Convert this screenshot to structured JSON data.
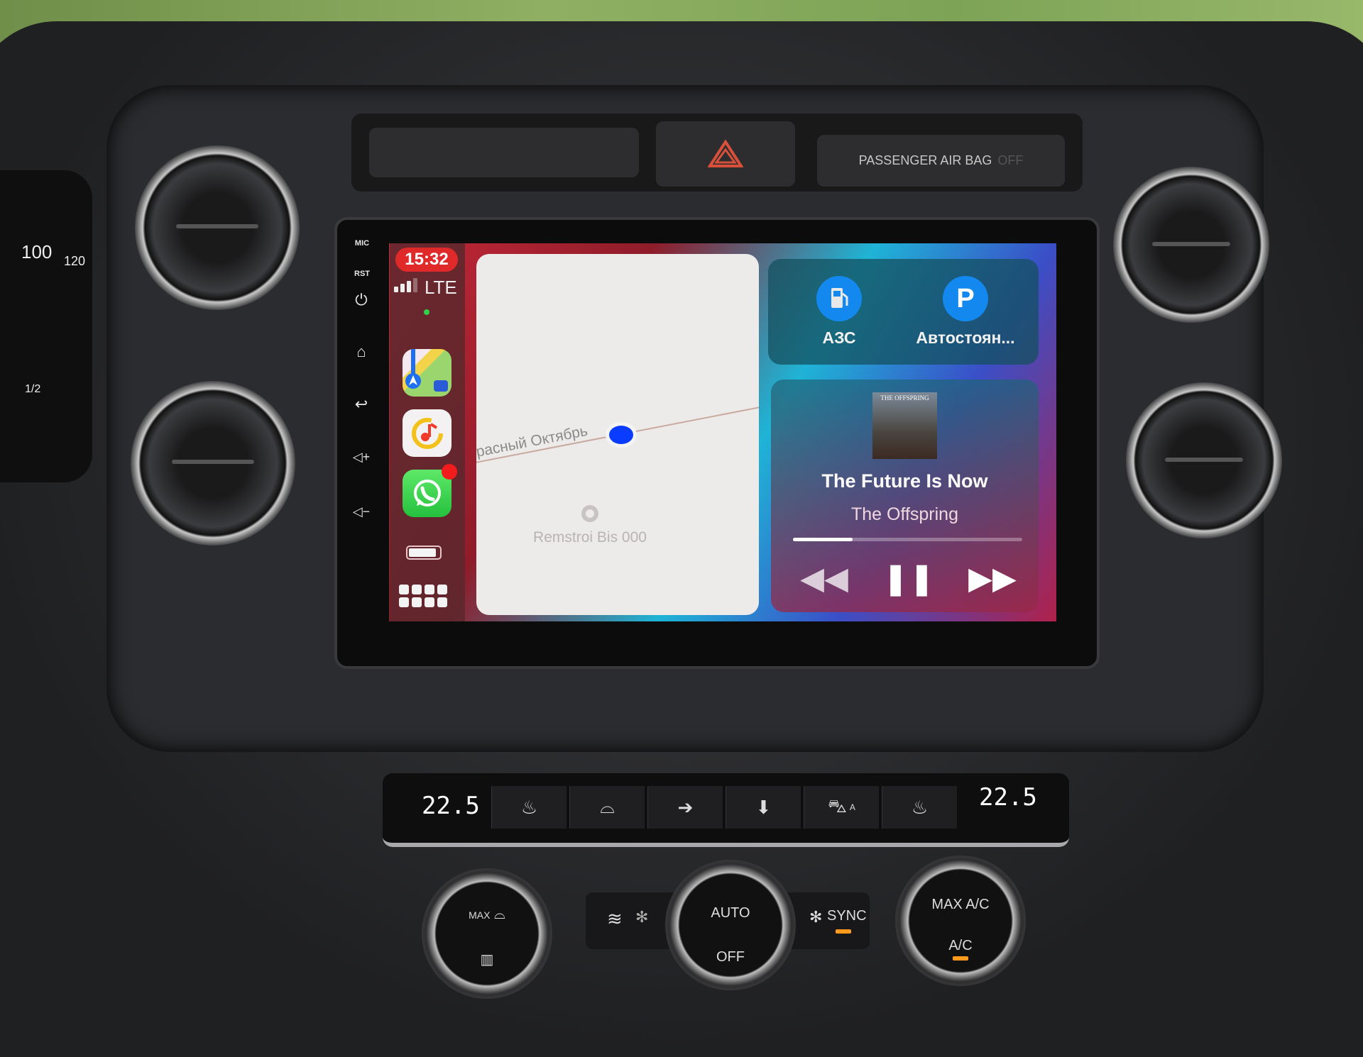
{
  "top_panel": {
    "airbag_label": "PASSENGER AIR BAG",
    "airbag_state": "OFF"
  },
  "cluster": {
    "speed_marks": [
      "100",
      "120"
    ],
    "fuel_mark": "1/2"
  },
  "head_unit": {
    "side_buttons": {
      "mic": "MIC",
      "rst": "RST"
    }
  },
  "carplay": {
    "status": {
      "time": "15:32",
      "network": "LTE",
      "signal_bars": 3
    },
    "dock": {
      "apps": [
        {
          "name": "Maps",
          "icon": "maps-icon"
        },
        {
          "name": "Music",
          "icon": "music-icon"
        },
        {
          "name": "WhatsApp",
          "icon": "whatsapp-icon",
          "badge": true
        }
      ],
      "battery_level": 0.9
    },
    "map": {
      "road_name": "расный Октябрь",
      "poi_name": "Remstroi Bis 000"
    },
    "shortcuts": [
      {
        "label": "АЗС",
        "icon": "fuel-pump-icon"
      },
      {
        "label": "Автостоян...",
        "icon": "P"
      }
    ],
    "now_playing": {
      "album_text": "THE OFFSPRING",
      "title": "The Future Is Now",
      "artist": "The Offspring",
      "progress_percent": 26
    },
    "accent": "#1389ef"
  },
  "climate": {
    "left_temp": "22.5",
    "right_temp": "22.5",
    "auto_label": "AUTO",
    "off_label": "OFF",
    "sync_label": "SYNC",
    "max_label": "MAX",
    "maxac_label": "MAX A/C",
    "ac_label": "A/C",
    "a_label": "A"
  }
}
